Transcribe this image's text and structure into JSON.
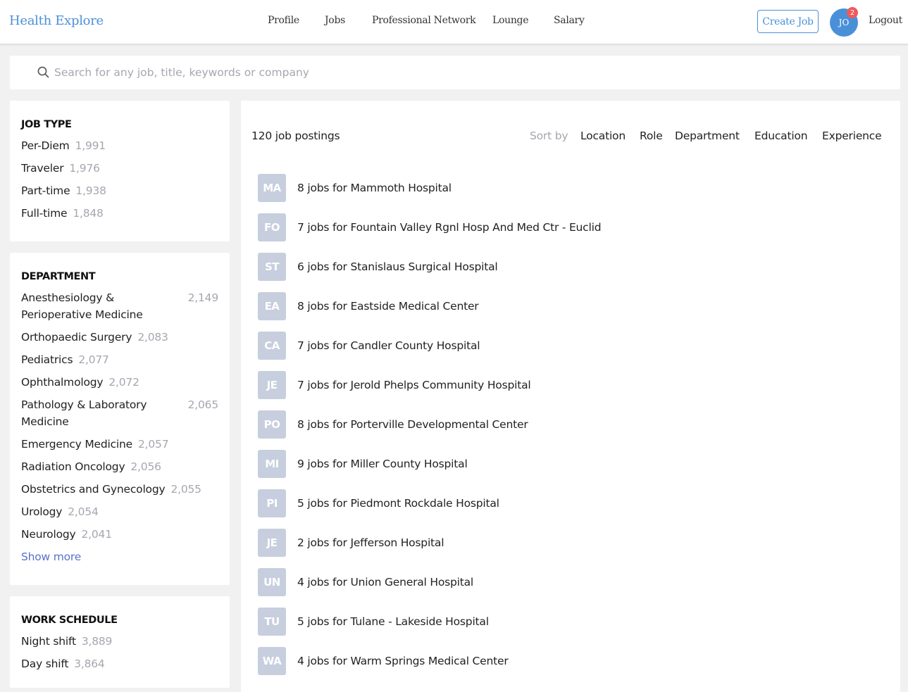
{
  "header": {
    "brand": "Health Explore",
    "nav": [
      "Profile",
      "Jobs",
      "Professional Network",
      "Lounge",
      "Salary"
    ],
    "create_job_label": "Create Job",
    "avatar_initials": "JO",
    "notification_count": "2",
    "logout_label": "Logout"
  },
  "search": {
    "placeholder": "Search for any job, title, keywords or company",
    "value": ""
  },
  "filters": {
    "job_type": {
      "title": "JOB TYPE",
      "items": [
        {
          "name": "Per-Diem",
          "count": "1,991"
        },
        {
          "name": "Traveler",
          "count": "1,976"
        },
        {
          "name": "Part-time",
          "count": "1,938"
        },
        {
          "name": "Full-time",
          "count": "1,848"
        }
      ]
    },
    "department": {
      "title": "DEPARTMENT",
      "items": [
        {
          "name": "Anesthesiology & Perioperative Medicine",
          "count": "2,149"
        },
        {
          "name": "Orthopaedic Surgery",
          "count": "2,083"
        },
        {
          "name": "Pediatrics",
          "count": "2,077"
        },
        {
          "name": "Ophthalmology",
          "count": "2,072"
        },
        {
          "name": "Pathology & Laboratory Medicine",
          "count": "2,065"
        },
        {
          "name": "Emergency Medicine",
          "count": "2,057"
        },
        {
          "name": "Radiation Oncology",
          "count": "2,056"
        },
        {
          "name": "Obstetrics and Gynecology",
          "count": "2,055"
        },
        {
          "name": "Urology",
          "count": "2,054"
        },
        {
          "name": "Neurology",
          "count": "2,041"
        }
      ],
      "show_more": "Show more"
    },
    "work_schedule": {
      "title": "WORK SCHEDULE",
      "items": [
        {
          "name": "Night shift",
          "count": "3,889"
        },
        {
          "name": "Day shift",
          "count": "3,864"
        }
      ]
    }
  },
  "results": {
    "count_label": "120 job postings",
    "sort_label": "Sort by",
    "sort_options": [
      "Location",
      "Role",
      "Department",
      "Education",
      "Experience"
    ],
    "jobs": [
      {
        "initials": "MA",
        "label": "8 jobs for Mammoth Hospital"
      },
      {
        "initials": "FO",
        "label": "7 jobs for Fountain Valley Rgnl Hosp And Med Ctr - Euclid"
      },
      {
        "initials": "ST",
        "label": "6 jobs for Stanislaus Surgical Hospital"
      },
      {
        "initials": "EA",
        "label": "8 jobs for Eastside Medical Center"
      },
      {
        "initials": "CA",
        "label": "7 jobs for Candler County Hospital"
      },
      {
        "initials": "JE",
        "label": "7 jobs for Jerold Phelps Community Hospital"
      },
      {
        "initials": "PO",
        "label": "8 jobs for Porterville Developmental Center"
      },
      {
        "initials": "MI",
        "label": "9 jobs for Miller County Hospital"
      },
      {
        "initials": "PI",
        "label": "5 jobs for Piedmont Rockdale Hospital"
      },
      {
        "initials": "JE",
        "label": "2 jobs for Jefferson Hospital"
      },
      {
        "initials": "UN",
        "label": "4 jobs for Union General Hospital"
      },
      {
        "initials": "TU",
        "label": "5 jobs for Tulane - Lakeside Hospital"
      },
      {
        "initials": "WA",
        "label": "4 jobs for Warm Springs Medical Center"
      }
    ]
  },
  "colors": {
    "brand": "#4a90d9",
    "badge": "#ee5b5b",
    "muted_text": "#a6a6b0",
    "link": "#5a72c9",
    "avatar_tile": "#c7cede",
    "page_bg": "#f1f1f1"
  }
}
